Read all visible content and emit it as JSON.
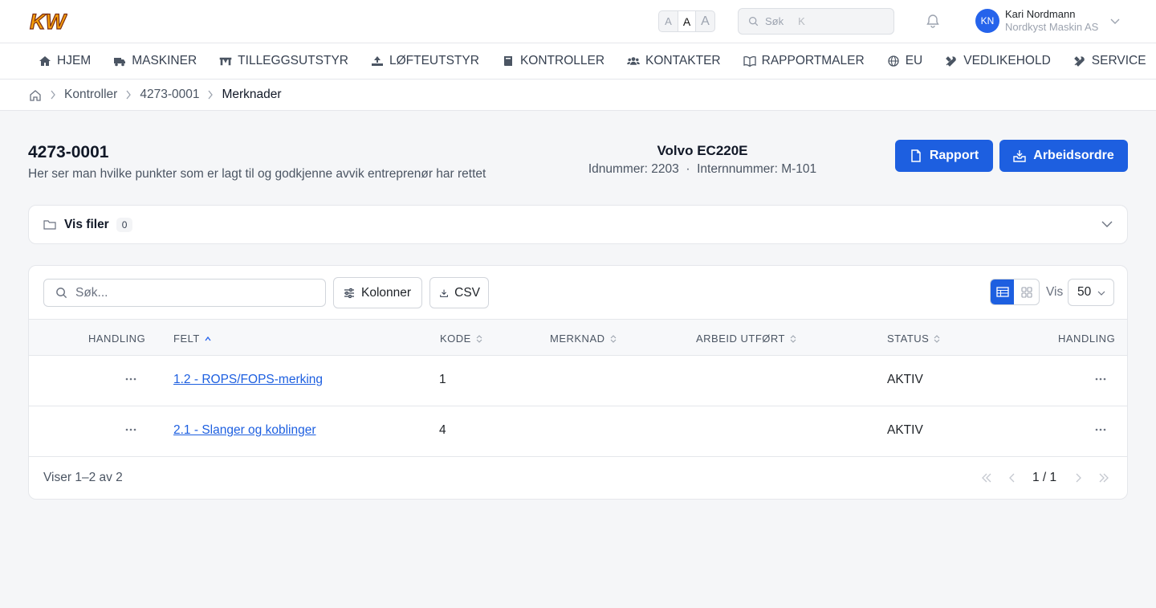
{
  "header": {
    "logo_text": "KW",
    "font_sizes": [
      "A",
      "A",
      "A"
    ],
    "search_placeholder": "Søk",
    "search_shortcut": "K",
    "user_initials": "KN",
    "user_name": "Kari Nordmann",
    "user_company": "Nordkyst Maskin AS"
  },
  "nav": {
    "items": [
      {
        "label": "HJEM",
        "icon": "home-icon"
      },
      {
        "label": "MASKINER",
        "icon": "truck-icon"
      },
      {
        "label": "TILLEGGSUTSTYR",
        "icon": "attachment-icon"
      },
      {
        "label": "LØFTEUTSTYR",
        "icon": "lifting-icon"
      },
      {
        "label": "KONTROLLER",
        "icon": "book-icon"
      },
      {
        "label": "KONTAKTER",
        "icon": "users-icon"
      },
      {
        "label": "RAPPORTMALER",
        "icon": "open-book-icon"
      },
      {
        "label": "EU",
        "icon": "globe-icon"
      },
      {
        "label": "VEDLIKEHOLD",
        "icon": "tools-icon"
      },
      {
        "label": "SERVICE",
        "icon": "tools-icon"
      }
    ]
  },
  "breadcrumb": {
    "items": [
      "Kontroller",
      "4273-0001",
      "Merknader"
    ]
  },
  "page": {
    "title": "4273-0001",
    "subtitle": "Her ser man hvilke punkter som er lagt til og godkjenne avvik entreprenør har rettet",
    "machine_name": "Volvo EC220E",
    "machine_ids": "Idnummer: 2203  ·  Internnummer: M-101",
    "report_button": "Rapport",
    "workorder_button": "Arbeidsordre"
  },
  "files": {
    "label": "Vis filer",
    "count": "0"
  },
  "table": {
    "search_placeholder": "Søk...",
    "columns_button": "Kolonner",
    "csv_button": "CSV",
    "show_label": "Vis",
    "page_size": "50",
    "headers": [
      "HANDLING",
      "FELT",
      "KODE",
      "MERKNAD",
      "ARBEID UTFØRT",
      "STATUS",
      "HANDLING"
    ],
    "rows": [
      {
        "felt": "1.2 - ROPS/FOPS-merking",
        "kode": "1",
        "merknad": "",
        "arbeid": "",
        "status": "AKTIV"
      },
      {
        "felt": "2.1 - Slanger og koblinger",
        "kode": "4",
        "merknad": "",
        "arbeid": "",
        "status": "AKTIV"
      }
    ],
    "footer_info": "Viser 1–2 av 2",
    "page_indicator": "1 / 1"
  },
  "colors": {
    "primary": "#1d5fe0",
    "logo_orange": "#f59e0b"
  }
}
